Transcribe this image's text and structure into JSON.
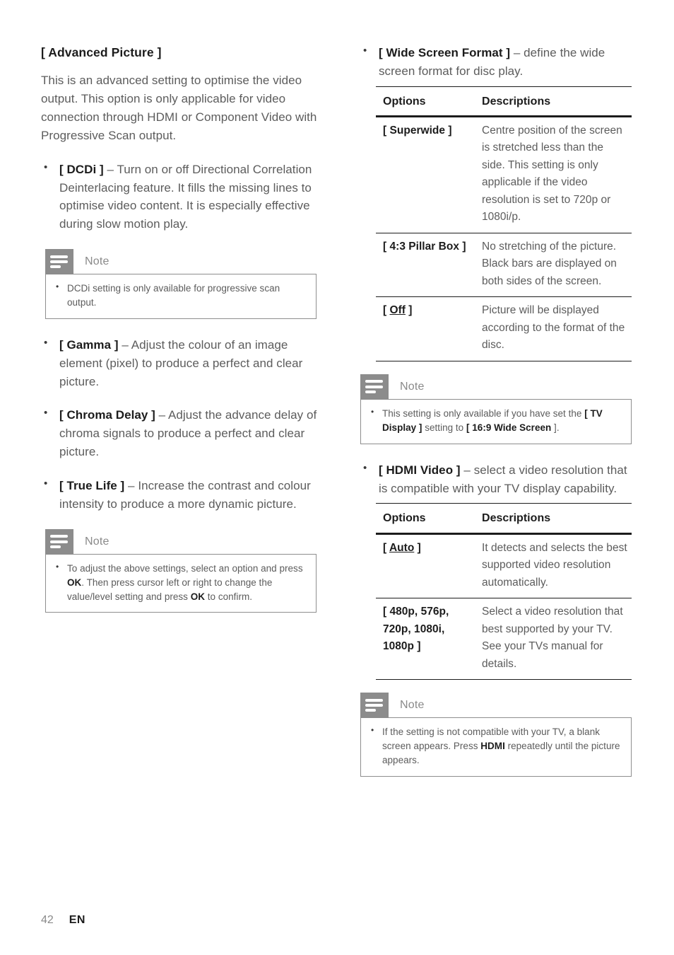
{
  "page": {
    "number": "42",
    "language": "EN"
  },
  "left_column": {
    "section_title": "[ Advanced Picture ]",
    "intro_paragraph": "This is an advanced setting to optimise the video output. This option is only applicable for video connection through HDMI or Component Video with Progressive Scan output.",
    "bullets": [
      {
        "term": "[ DCDi ]",
        "dash": "–",
        "description": "Turn on or off Directional Correlation Deinterlacing feature.  It fills the missing lines to optimise video content.  It is especially effective during slow motion play."
      },
      {
        "term": "[ Gamma ]",
        "dash": "–",
        "description": "Adjust the colour of an image element (pixel) to produce a perfect and clear picture."
      },
      {
        "term": "[ Chroma Delay ]",
        "dash": "–",
        "description": "Adjust the advance delay of chroma signals to produce a perfect and clear picture."
      },
      {
        "term": "[ True Life ]",
        "dash": "–",
        "description": "Increase the contrast and colour intensity to produce a more dynamic picture."
      }
    ],
    "note_dcdi": {
      "label": "Note",
      "text": "DCDi setting is only available for progressive scan output."
    },
    "note_adjust": {
      "label": "Note",
      "text_1": "To adjust the above settings, select an option and press ",
      "kbd_1": "OK",
      "text_2": ".  Then press cursor left or right to change the value/level setting and press ",
      "kbd_2": "OK",
      "text_3": " to confirm."
    }
  },
  "right_column": {
    "bullet_wide_screen": {
      "term": "[ Wide Screen Format ]",
      "dash": "–",
      "description": "define the wide screen format for disc play."
    },
    "table_wide_screen": {
      "headers": [
        "Options",
        "Descriptions"
      ],
      "rows": [
        {
          "option": "[ Superwide ]",
          "option_underline": "",
          "description": "Centre position of the screen is stretched less than the side.  This setting is only applicable if the video resolution is set to 720p or 1080i/p."
        },
        {
          "option": "[ 4:3 Pillar Box ]",
          "option_underline": "",
          "description": "No stretching of the picture.  Black bars are displayed on both sides of the screen."
        },
        {
          "option": "[ Off ]",
          "option_underline": "Off",
          "description": "Picture will be displayed according to the format of the disc."
        }
      ]
    },
    "note_wide_screen": {
      "label": "Note",
      "text_1": "This setting is only available if you have set the ",
      "kbd_1": "[ TV Display ]",
      "text_2": " setting to ",
      "kbd_2": "[ 16:9 Wide Screen",
      "text_3": " ]."
    },
    "bullet_hdmi_video": {
      "term": "[ HDMI Video ]",
      "dash": "–",
      "description": "select a video resolution that is compatible with your TV display capability."
    },
    "table_hdmi_video": {
      "headers": [
        "Options",
        "Descriptions"
      ],
      "rows": [
        {
          "option": "[ Auto ]",
          "option_underline": "Auto",
          "description": "It detects and selects the best supported video resolution automatically."
        },
        {
          "option": "[ 480p, 576p, 720p, 1080i, 1080p ]",
          "option_underline": "",
          "description": "Select a video resolution that best supported by your TV.  See your TVs manual for details."
        }
      ]
    },
    "note_hdmi": {
      "label": "Note",
      "text_1": "If the setting is not compatible with your TV, a blank screen appears. Press ",
      "kbd_1": "HDMI",
      "text_2": " repeatedly until the picture appears."
    }
  },
  "icons": {
    "note_icon": "note-lines-icon"
  },
  "colors": {
    "body_text": "#5c5c5c",
    "heading_text": "#1c1c1c",
    "note_icon_bg": "#8c8c8c",
    "note_border": "#8e8e8e",
    "table_rule": "#1c1c1c"
  }
}
